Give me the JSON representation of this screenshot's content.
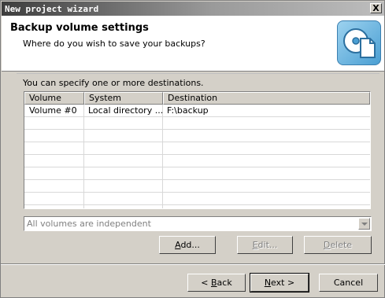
{
  "window": {
    "title": "New project wizard",
    "close_glyph": "X"
  },
  "header": {
    "title": "Backup volume settings",
    "subtitle": "Where do you wish to save your backups?",
    "icon": "disk-copy-icon"
  },
  "content": {
    "destinations_label": "You can specify one or more destinations."
  },
  "table": {
    "columns": [
      "Volume",
      "System",
      "Destination"
    ],
    "rows": [
      {
        "volume": "Volume #0",
        "system": "Local directory ...",
        "destination": "F:\\backup"
      }
    ]
  },
  "combo": {
    "value": "All volumes are independent"
  },
  "buttons": {
    "add": {
      "prefix": "",
      "underline": "A",
      "suffix": "dd..."
    },
    "edit": {
      "prefix": "",
      "underline": "E",
      "suffix": "dit..."
    },
    "delete": {
      "prefix": "",
      "underline": "D",
      "suffix": "elete"
    },
    "back": {
      "prefix": "< ",
      "underline": "B",
      "suffix": "ack"
    },
    "next": {
      "prefix": "",
      "underline": "N",
      "suffix": "ext >"
    },
    "cancel": {
      "prefix": "",
      "underline": "",
      "suffix": "Cancel"
    }
  }
}
